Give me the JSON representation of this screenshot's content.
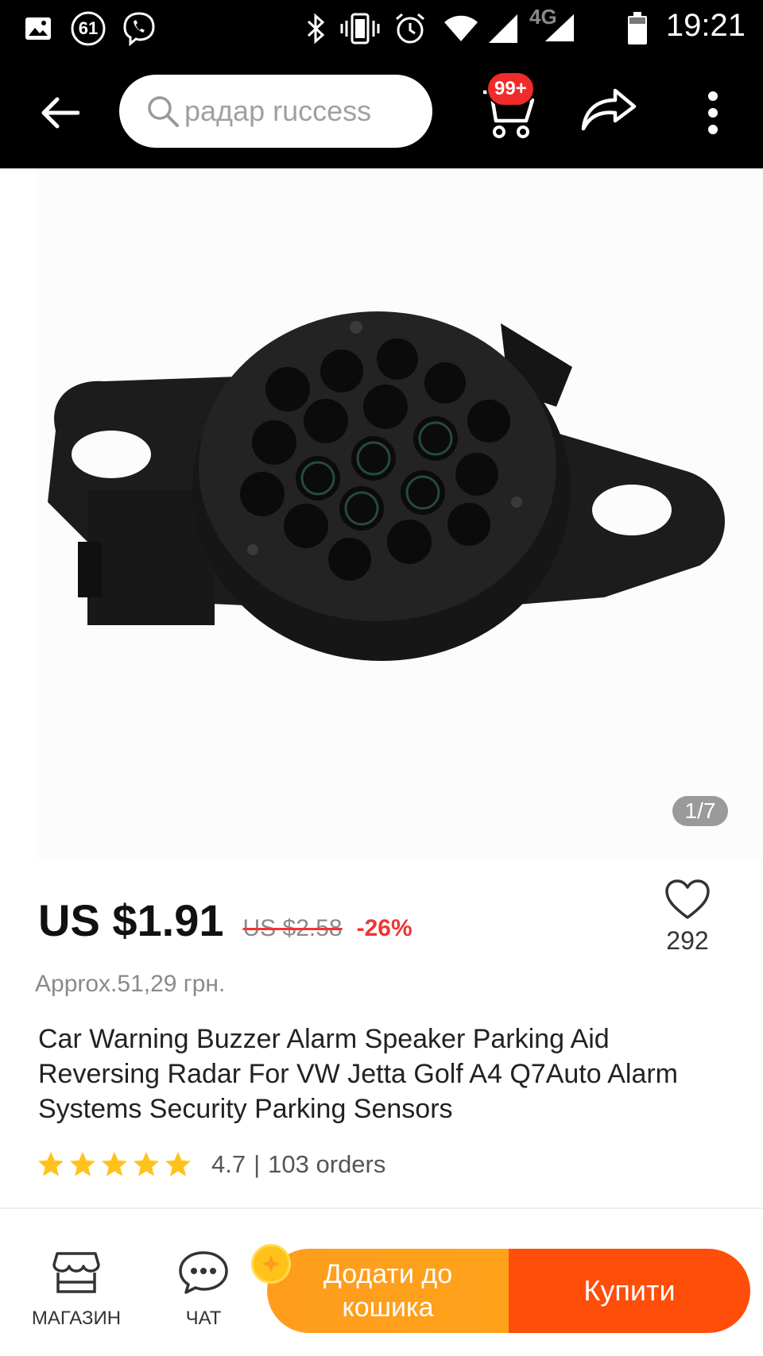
{
  "status_bar": {
    "time": "19:21",
    "notification_count": "61",
    "network": "4G",
    "icons": [
      "image-icon",
      "notification-count-icon",
      "viber-icon",
      "bluetooth-icon",
      "vibrate-icon",
      "alarm-icon",
      "wifi-icon",
      "signal-icon",
      "signal-4g-icon",
      "battery-icon"
    ]
  },
  "header": {
    "search_placeholder": "радар ruccess",
    "cart_badge": "99+",
    "icons": [
      "back-arrow-icon",
      "search-icon",
      "cart-icon",
      "share-icon",
      "more-vertical-icon"
    ]
  },
  "gallery": {
    "page_indicator": "1/7",
    "image_alt": "Car parking buzzer speaker"
  },
  "product": {
    "price": "US $1.91",
    "old_price": "US $2.58",
    "discount": "-26%",
    "wishlist_count": "292",
    "approx_price": "Approx.51,29 грн.",
    "title": "Car Warning Buzzer Alarm Speaker Parking Aid Reversing Radar For VW Jetta Golf A4 Q7Auto Alarm Systems Security Parking Sensors",
    "rating": "4.7",
    "rating_stars": 4.7,
    "rating_separator": "|",
    "orders": "103 orders"
  },
  "bottom_bar": {
    "store_label": "МАГАЗИН",
    "chat_label": "ЧАТ",
    "add_to_cart_label": "Додати до кошика",
    "buy_label": "Купити"
  },
  "colors": {
    "header_bg": "#000000",
    "badge_red": "#f02b2b",
    "discount_red": "#f03434",
    "add_to_cart": "#ffa21a",
    "buy": "#ff4d0a",
    "star": "#ffc21a"
  }
}
